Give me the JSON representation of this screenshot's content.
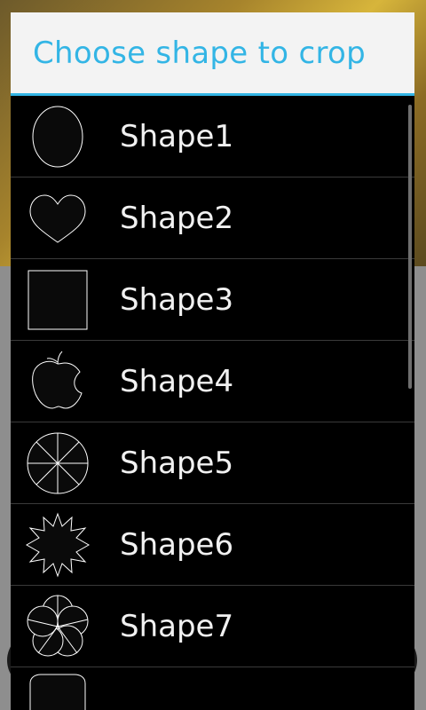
{
  "dialog": {
    "title": "Choose shape to crop",
    "items": [
      {
        "label": "Shape1",
        "icon": "ellipse-icon"
      },
      {
        "label": "Shape2",
        "icon": "heart-icon"
      },
      {
        "label": "Shape3",
        "icon": "square-icon"
      },
      {
        "label": "Shape4",
        "icon": "apple-icon"
      },
      {
        "label": "Shape5",
        "icon": "pinwheel-icon"
      },
      {
        "label": "Shape6",
        "icon": "starburst-icon"
      },
      {
        "label": "Shape7",
        "icon": "flower-icon"
      },
      {
        "label": "",
        "icon": "partial-shape-icon"
      }
    ]
  },
  "colors": {
    "accent": "#33b5e5",
    "dialog_background": "#000000",
    "header_background": "#f3f3f3",
    "text": "#f1f1f1"
  }
}
